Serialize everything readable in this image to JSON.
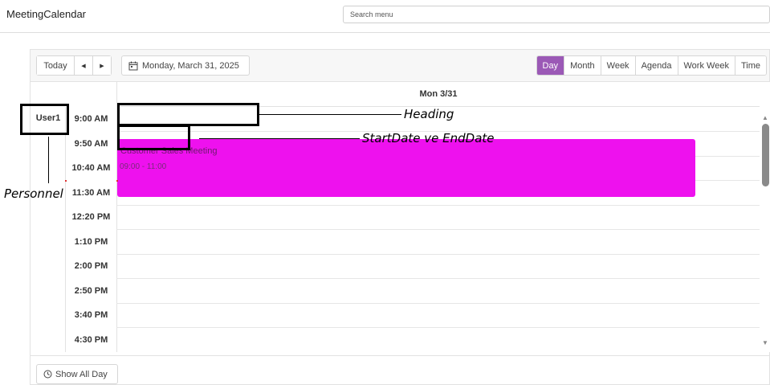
{
  "app": {
    "title": "MeetingCalendar"
  },
  "search": {
    "placeholder": "Search menu"
  },
  "toolbar": {
    "today_label": "Today",
    "prev_icon": "◀",
    "next_icon": "▶",
    "date_label": "Monday, March 31, 2025",
    "calendar_icon": "calendar-icon"
  },
  "views": {
    "items": [
      {
        "label": "Day",
        "active": true
      },
      {
        "label": "Month",
        "active": false
      },
      {
        "label": "Week",
        "active": false
      },
      {
        "label": "Agenda",
        "active": false
      },
      {
        "label": "Work Week",
        "active": false
      },
      {
        "label": "Time",
        "active": false
      }
    ]
  },
  "grid": {
    "date_header": "Mon 3/31",
    "group": "User1",
    "times": [
      "9:00 AM",
      "9:50 AM",
      "10:40 AM",
      "11:30 AM",
      "12:20 PM",
      "1:10 PM",
      "2:00 PM",
      "2:50 PM",
      "3:40 PM",
      "4:30 PM"
    ]
  },
  "event": {
    "title": "Customer Sales Meeting",
    "time": "09:00 - 11:00",
    "color": "#ee11ee"
  },
  "footer": {
    "show_all_day_label": "Show All Day",
    "clock_icon": "clock-icon"
  },
  "annotations": {
    "heading": "Heading",
    "dates": "StartDate ve EndDate",
    "personnel": "Personnel"
  },
  "colors": {
    "accent": "#9b59b6",
    "border": "#e2e2e2"
  }
}
